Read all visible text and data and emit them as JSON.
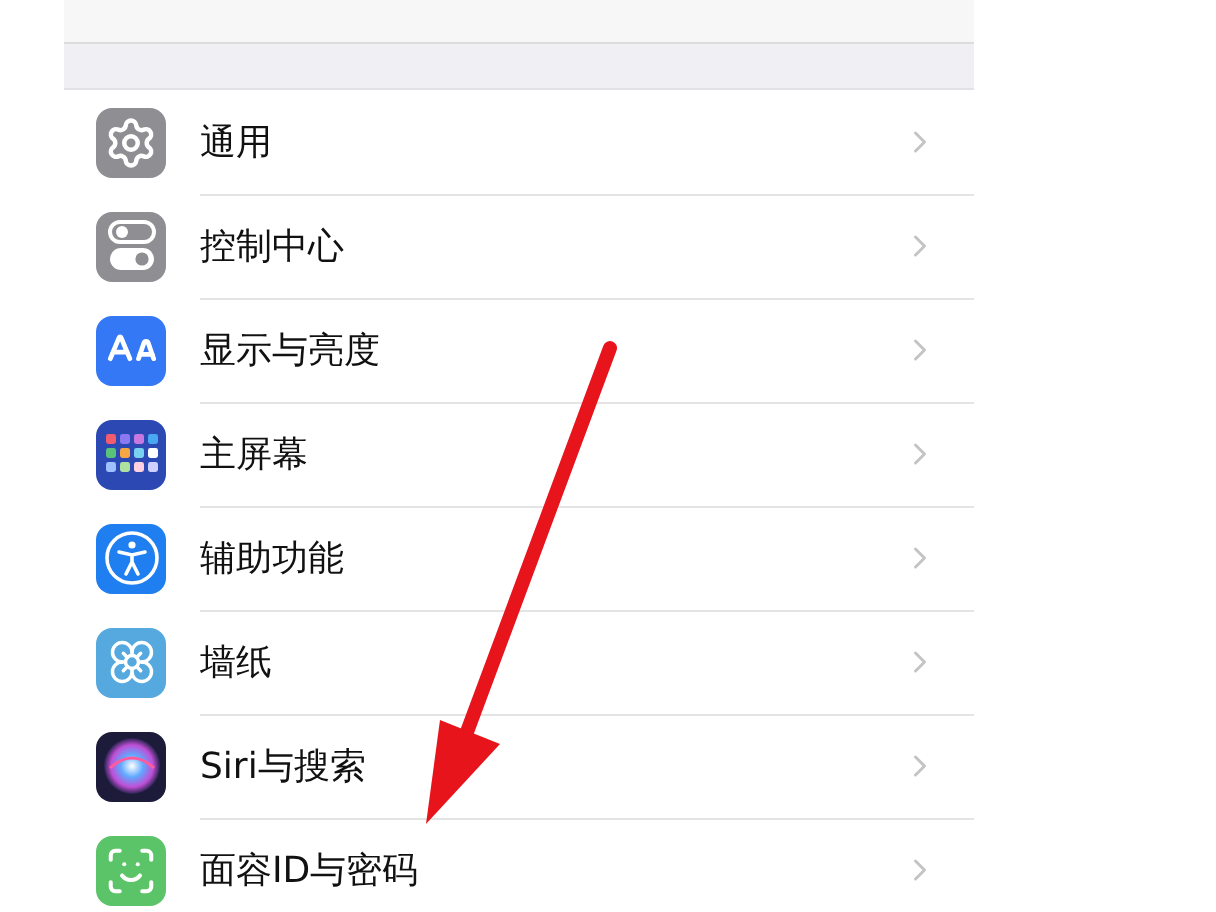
{
  "settings_list": [
    {
      "label": "通用",
      "kind": "gear",
      "color": "#8e8e93"
    },
    {
      "label": "控制中心",
      "kind": "toggles",
      "color": "#8e8e93"
    },
    {
      "label": "显示与亮度",
      "kind": "textsize",
      "color": "#3478f6"
    },
    {
      "label": "主屏幕",
      "kind": "grid",
      "color": "#2b48b3"
    },
    {
      "label": "辅助功能",
      "kind": "accessibility",
      "color": "#1f7ef0"
    },
    {
      "label": "墙纸",
      "kind": "flower",
      "color": "#55a9de"
    },
    {
      "label": "Siri与搜索",
      "kind": "siri",
      "color": "#1d1b3a"
    },
    {
      "label": "面容ID与密码",
      "kind": "face",
      "color": "#5cc468"
    }
  ]
}
